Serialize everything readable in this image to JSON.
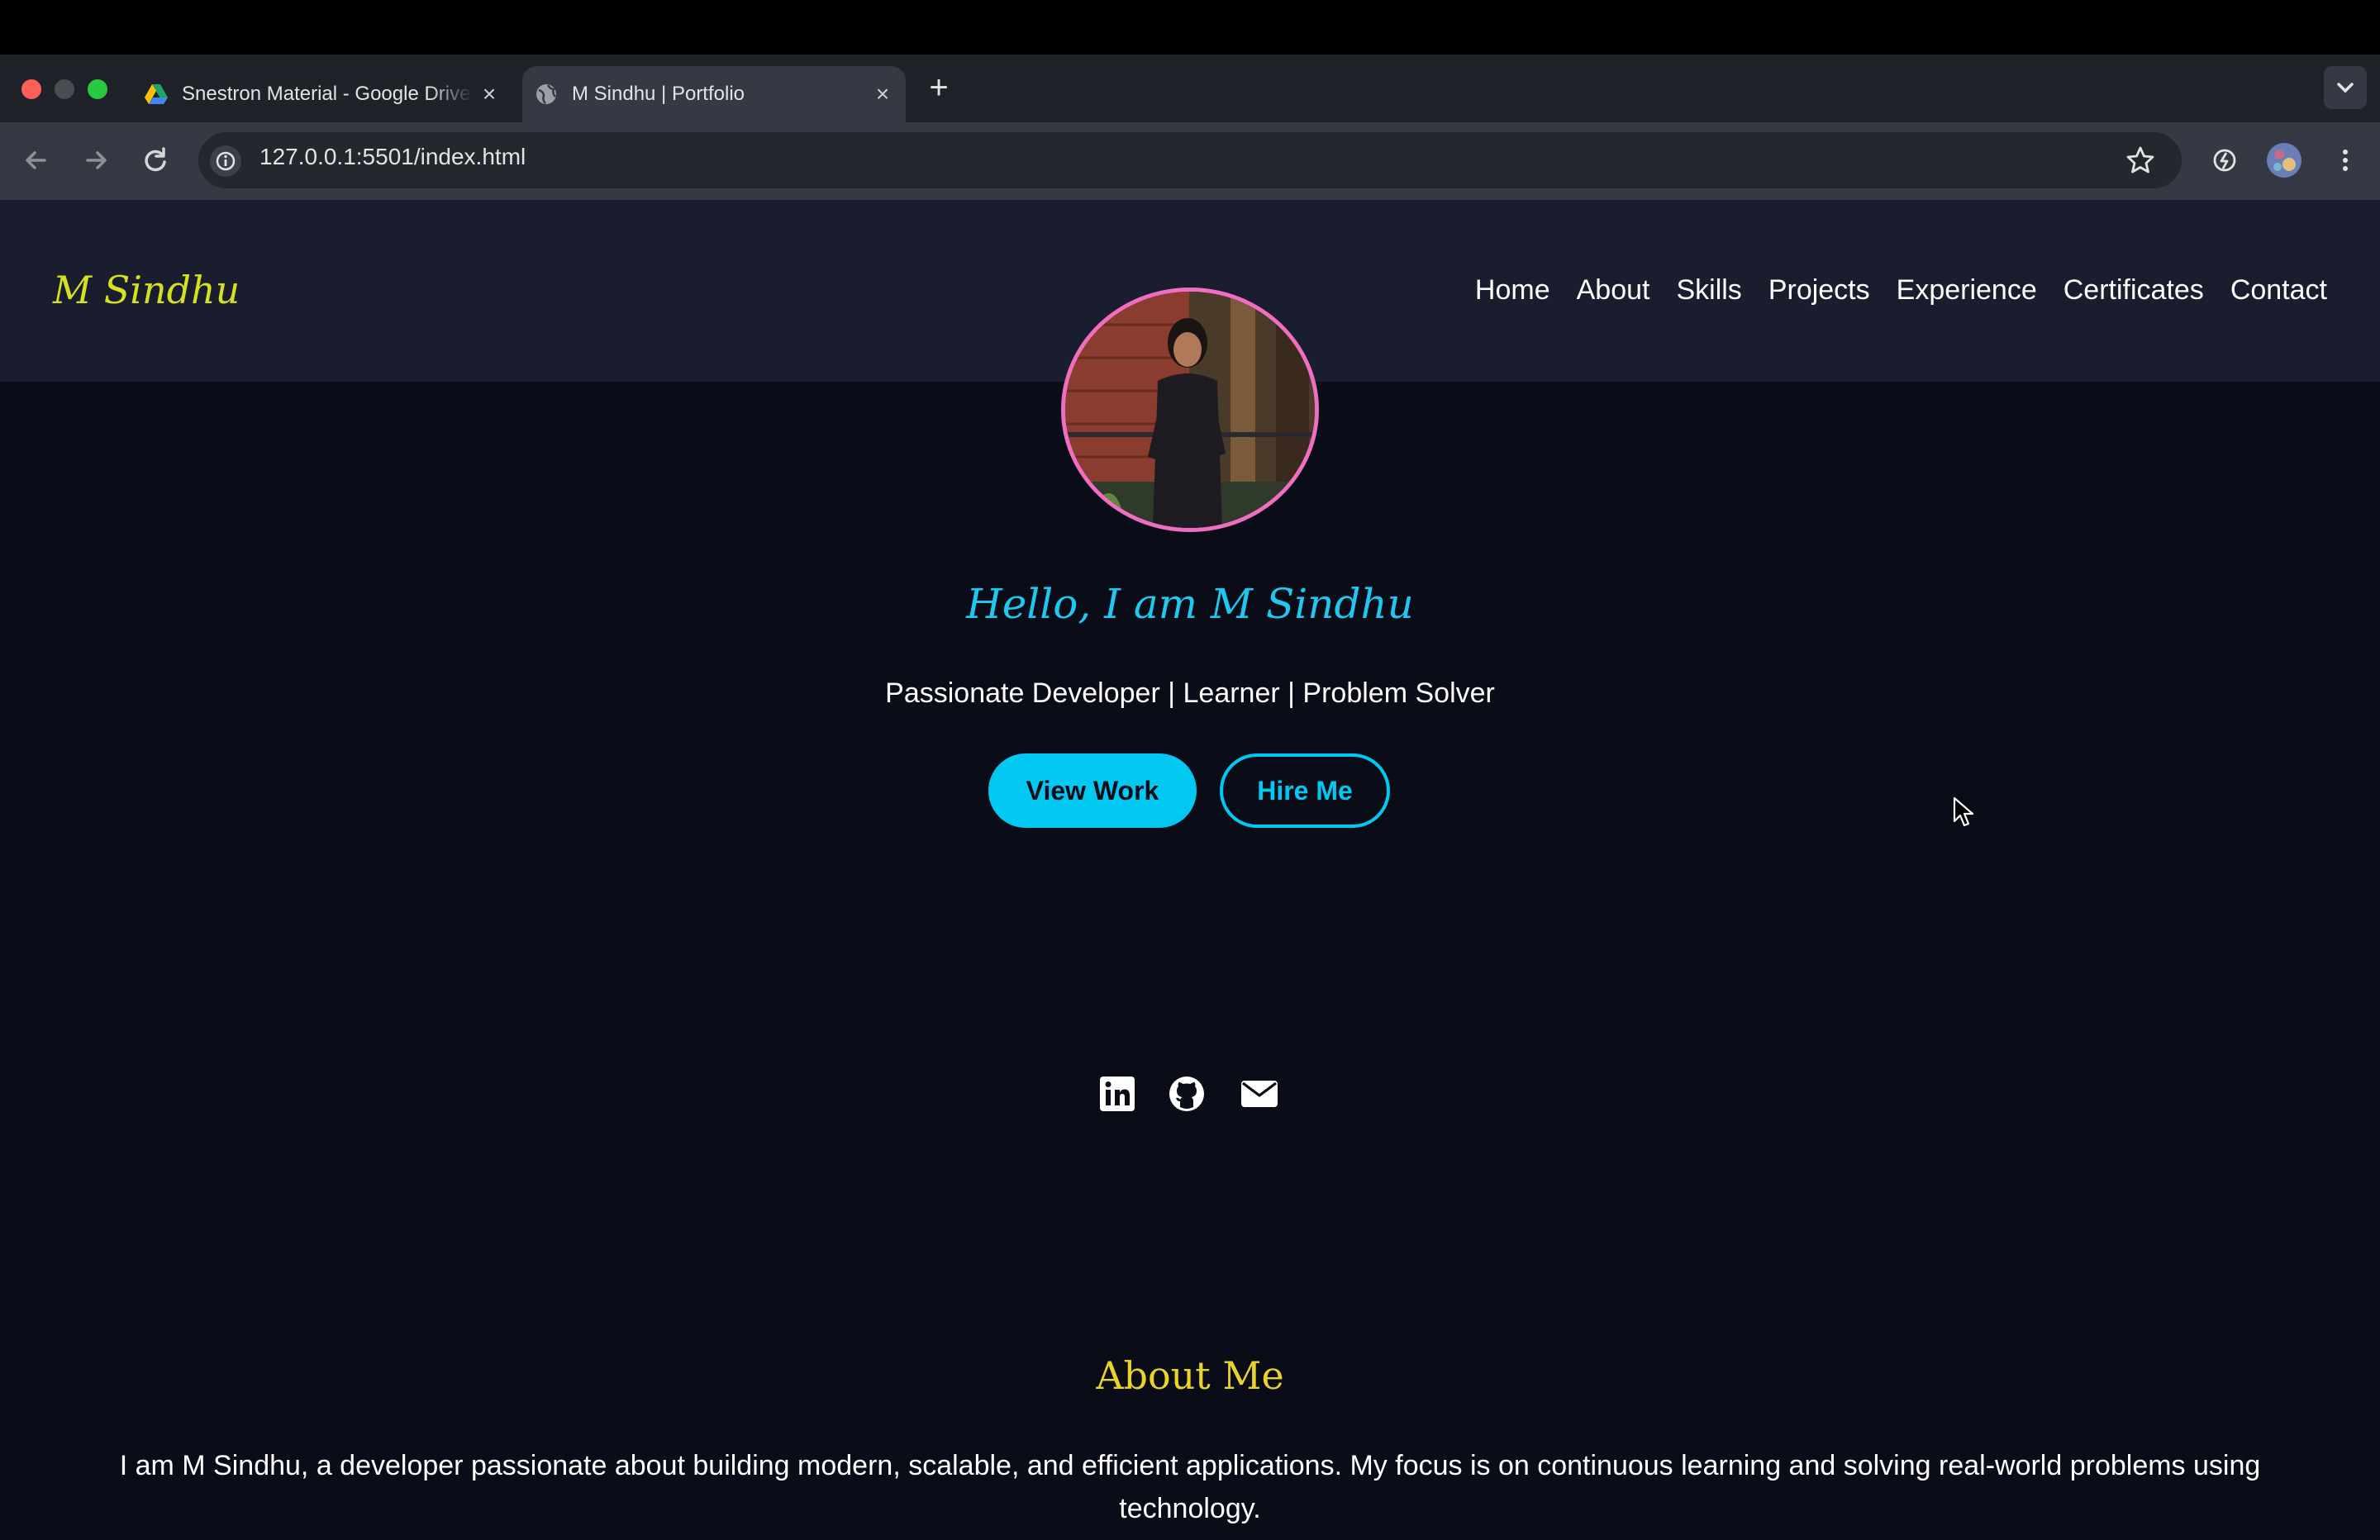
{
  "browser": {
    "tabs": [
      {
        "title": "Snestron Material - Google Drive",
        "active": false,
        "icon": "google-drive-icon"
      },
      {
        "title": "M Sindhu | Portfolio",
        "active": true,
        "icon": "globe-icon"
      }
    ],
    "url": "127.0.0.1:5501/index.html"
  },
  "site": {
    "logo": "M Sindhu",
    "nav": [
      "Home",
      "About",
      "Skills",
      "Projects",
      "Experience",
      "Certificates",
      "Contact"
    ],
    "hero": {
      "greeting": "Hello, I am M Sindhu",
      "tagline": "Passionate Developer | Learner | Problem Solver",
      "primary_button": "View Work",
      "secondary_button": "Hire Me",
      "social_icons": [
        "linkedin-icon",
        "github-icon",
        "mail-icon"
      ]
    },
    "about": {
      "title": "About Me",
      "text": "I am M Sindhu, a developer passionate about building modern, scalable, and efficient applications. My focus is on continuous learning and solving real-world problems using technology."
    }
  },
  "colors": {
    "background": "#0a0c18",
    "nav_background": "#191d2e",
    "logo": "#d4e020",
    "accent": "#00c8f0",
    "avatar_border": "#f06ec2",
    "about_title": "#e8d428"
  }
}
